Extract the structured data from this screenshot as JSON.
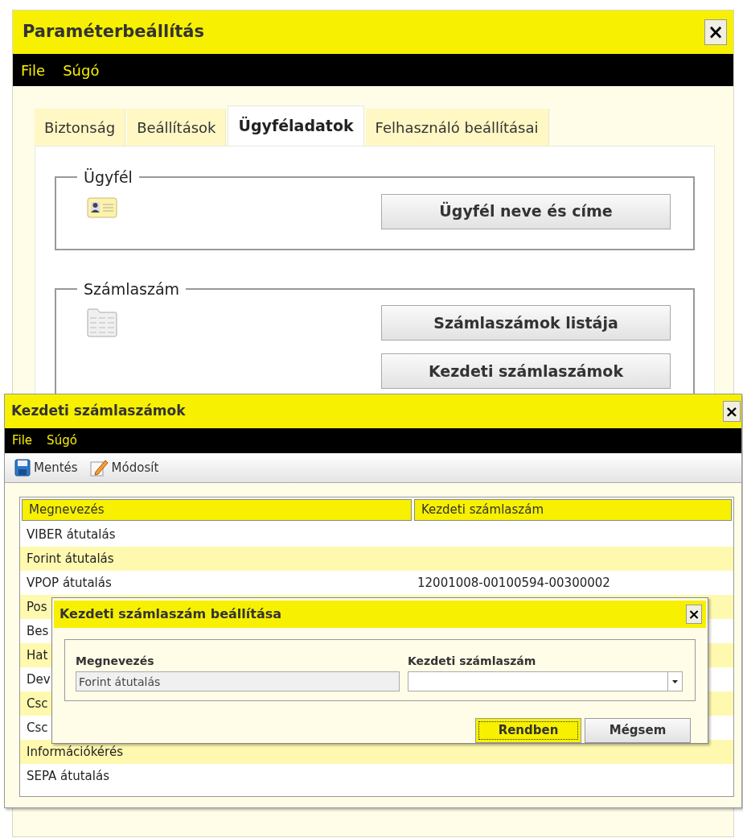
{
  "main_window": {
    "title": "Paraméterbeállítás",
    "close": "×",
    "menu": [
      "File",
      "Súgó"
    ],
    "tabs": [
      {
        "label": "Biztonság",
        "selected": false
      },
      {
        "label": "Beállítások",
        "selected": false
      },
      {
        "label": "Ügyféladatok",
        "selected": true
      },
      {
        "label": "Felhasználó beállításai",
        "selected": false
      }
    ],
    "groups": [
      {
        "label": "Ügyfél",
        "buttons": [
          "Ügyfél neve és címe"
        ]
      },
      {
        "label": "Számlaszám",
        "buttons": [
          "Számlaszámok listája",
          "Kezdeti számlaszámok"
        ]
      }
    ]
  },
  "list_window": {
    "title": "Kezdeti számlaszámok",
    "close": "×",
    "menu": [
      "File",
      "Súgó"
    ],
    "toolbar": [
      "Mentés",
      "Módosít"
    ],
    "table": {
      "columns": [
        "Megnevezés",
        "Kezdeti számlaszám"
      ],
      "rows": [
        {
          "name": "VIBER átutalás"
        },
        {
          "name": "Forint átutalás"
        },
        {
          "name": "VPOP átutalás",
          "account": "12001008-00100594-00300002"
        },
        {
          "name": "Pos"
        },
        {
          "name": "Bes"
        },
        {
          "name": "Hat"
        },
        {
          "name": "Dev"
        },
        {
          "name": "Csc"
        },
        {
          "name": "Csc"
        },
        {
          "name": "Információkérés"
        },
        {
          "name": "SEPA átutalás"
        }
      ]
    }
  },
  "dialog": {
    "title": "Kezdeti számlaszám beállítása",
    "close": "×",
    "fields": [
      {
        "label": "Megnevezés",
        "kind": "text",
        "value": "Forint átutalás",
        "disabled": true
      },
      {
        "label": "Kezdeti számlaszám",
        "kind": "dropdown",
        "disabled": false
      }
    ],
    "buttons": [
      {
        "label": "Rendben",
        "kind": "primary"
      },
      {
        "label": "Mégsem",
        "kind": "secondary"
      }
    ]
  }
}
